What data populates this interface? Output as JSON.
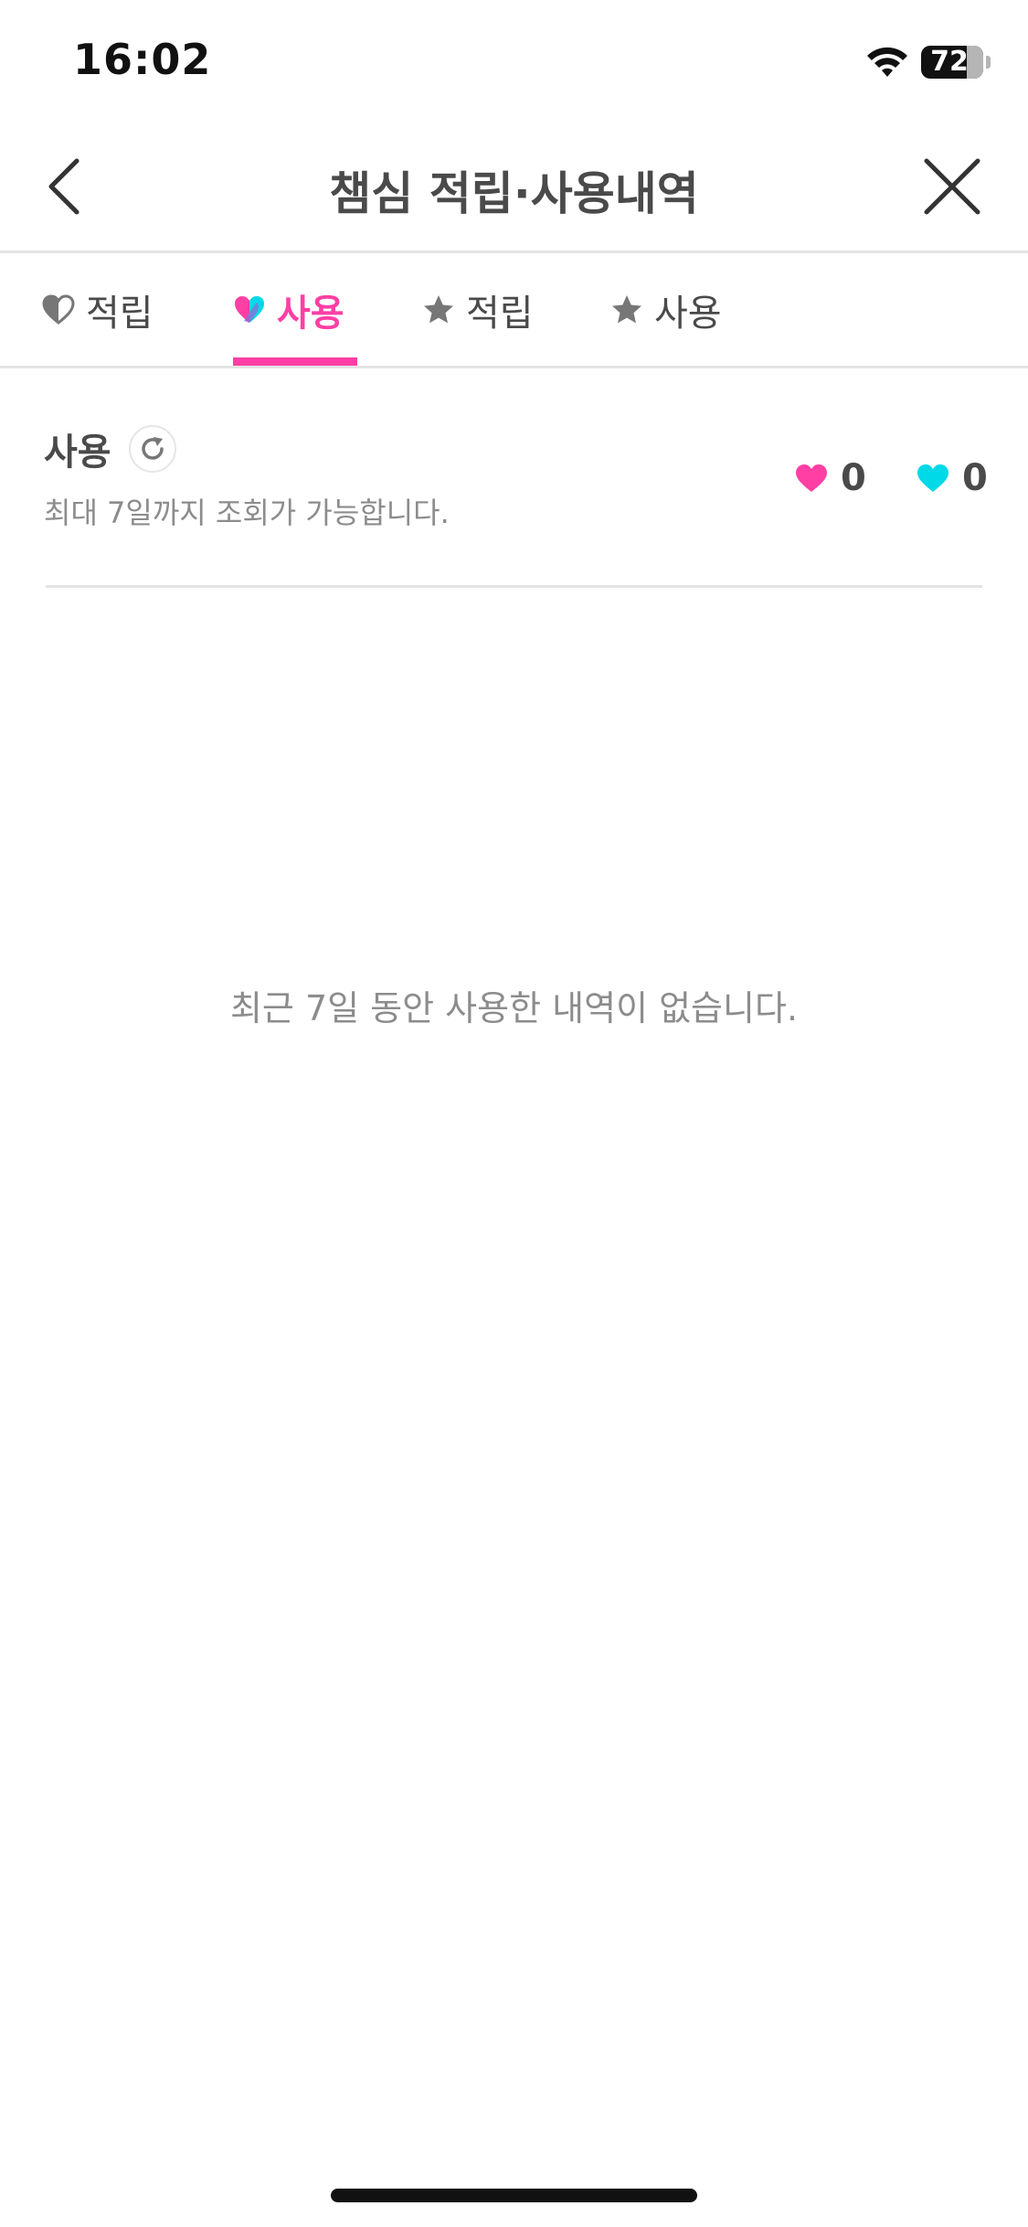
{
  "status_bar": {
    "time": "16:02",
    "battery_level": "72",
    "icons": [
      "wifi-icon",
      "battery-icon"
    ]
  },
  "header": {
    "title": "챔심 적립·사용내역",
    "back_icon": "chevron-left-icon",
    "close_icon": "close-icon"
  },
  "tabs": [
    {
      "label": "적립",
      "icon": "gray-heart-icon",
      "active": false
    },
    {
      "label": "사용",
      "icon": "two-tone-heart-icon",
      "active": true
    },
    {
      "label": "적립",
      "icon": "star-icon",
      "active": false
    },
    {
      "label": "사용",
      "icon": "star-icon",
      "active": false
    }
  ],
  "section": {
    "title": "사용",
    "subtitle": "최대 7일까지 조회가 가능합니다.",
    "refresh_icon": "refresh-icon"
  },
  "balances": [
    {
      "icon": "pink-heart-icon",
      "value": "0",
      "color": "#ff3fa4"
    },
    {
      "icon": "cyan-heart-icon",
      "value": "0",
      "color": "#00d9e8"
    }
  ],
  "empty_state": {
    "message": "최근 7일 동안 사용한 내역이 없습니다."
  },
  "colors": {
    "accent": "#ff3fa4",
    "cyan": "#00d9e8",
    "text": "#4a4a4a",
    "muted": "#8c8c8c",
    "divider": "#e4e4e4"
  }
}
